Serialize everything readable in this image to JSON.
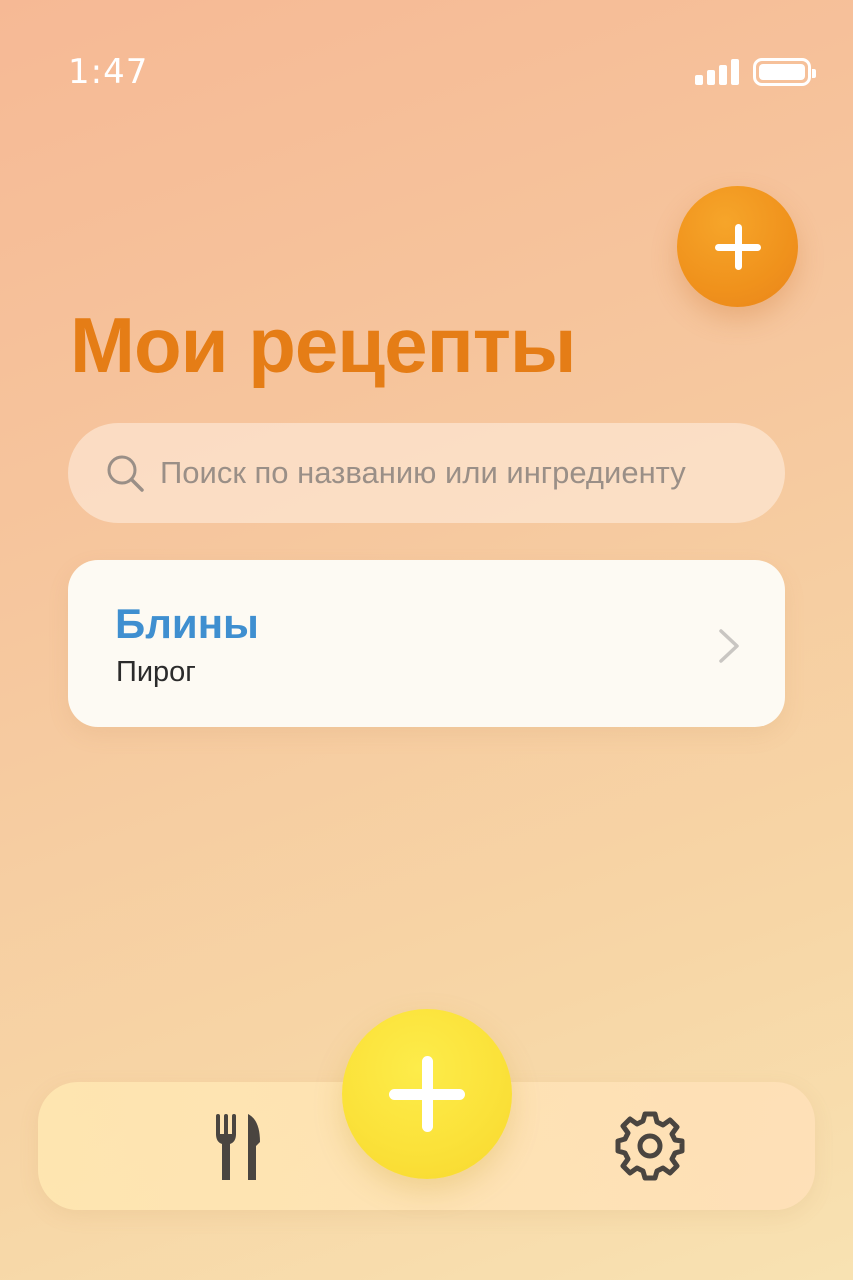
{
  "status_bar": {
    "time": "1:47",
    "icons": [
      "signal-icon",
      "battery-icon"
    ]
  },
  "header": {
    "add_button_icon": "plus-icon",
    "title": "Мои рецепты"
  },
  "search": {
    "placeholder": "Поиск по названию или ингредиенту",
    "icon": "search-icon"
  },
  "recipes": [
    {
      "title": "Блины",
      "category": "Пирог",
      "icon": "chevron-right-icon"
    }
  ],
  "tab_bar": {
    "items": [
      {
        "name": "recipes",
        "icon": "fork-knife-icon"
      },
      {
        "name": "add",
        "icon": "plus-icon"
      },
      {
        "name": "settings",
        "icon": "gear-icon"
      }
    ]
  },
  "colors": {
    "accent_orange": "#f0921c",
    "title_orange": "#e57d16",
    "recipe_title_blue": "#3f8fd0",
    "center_button_yellow": "#fbe23a",
    "icon_dark": "#4a4540"
  }
}
